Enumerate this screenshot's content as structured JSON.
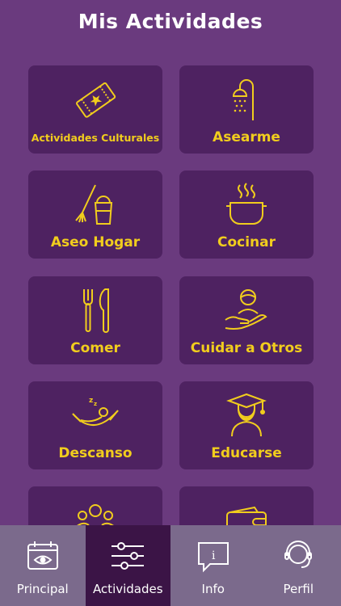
{
  "header": {
    "title": "Mis Actividades"
  },
  "activities": [
    {
      "label": "Actividades Culturales",
      "icon": "ticket-icon"
    },
    {
      "label": "Asearme",
      "icon": "shower-icon"
    },
    {
      "label": "Aseo Hogar",
      "icon": "broom-bucket-icon"
    },
    {
      "label": "Cocinar",
      "icon": "cooking-pot-icon"
    },
    {
      "label": "Comer",
      "icon": "fork-knife-icon"
    },
    {
      "label": "Cuidar a Otros",
      "icon": "caring-hand-icon"
    },
    {
      "label": "Descanso",
      "icon": "hammock-icon"
    },
    {
      "label": "Educarse",
      "icon": "graduate-icon"
    },
    {
      "label": "",
      "icon": "group-people-icon"
    },
    {
      "label": "",
      "icon": "wallet-icon"
    }
  ],
  "tabbar": {
    "tabs": [
      {
        "label": "Principal",
        "icon": "calendar-eye-icon",
        "active": false
      },
      {
        "label": "Actividades",
        "icon": "sliders-icon",
        "active": true
      },
      {
        "label": "Info",
        "icon": "info-bubble-icon",
        "active": false
      },
      {
        "label": "Perfil",
        "icon": "user-headset-icon",
        "active": false
      }
    ]
  },
  "colors": {
    "background": "#6a3a7e",
    "card": "#4e2261",
    "accent": "#f1cd1d",
    "tabbar": "#7b6a8c",
    "tab_active": "#3b1446"
  }
}
